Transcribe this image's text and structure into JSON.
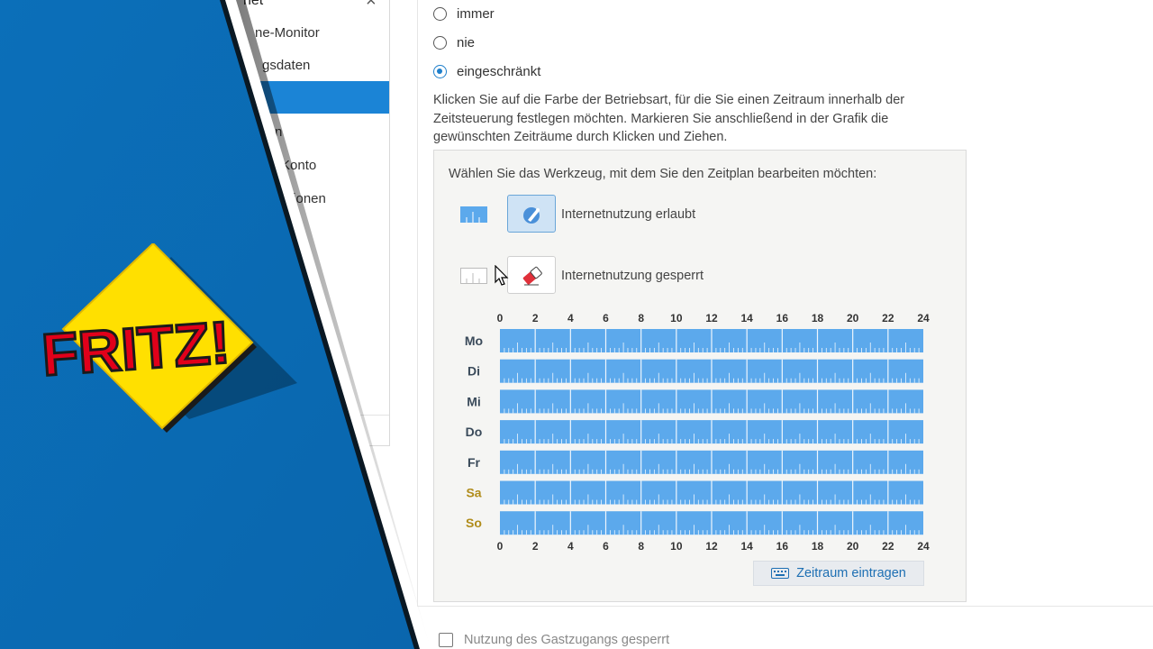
{
  "sidebar": {
    "head": "net",
    "items": [
      {
        "label": "ne-Monitor",
        "active": false
      },
      {
        "label": "gsdaten",
        "active": false
      },
      {
        "label": "",
        "active": true
      },
      {
        "label": "n",
        "active": false
      },
      {
        "label": "Konto",
        "active": false
      },
      {
        "label": "tionen",
        "active": false
      }
    ]
  },
  "logo": {
    "text": "FRITZ!"
  },
  "options": {
    "immer": "immer",
    "nie": "nie",
    "eingeschraenkt": "eingeschränkt",
    "selected": "eingeschraenkt"
  },
  "description": "Klicken Sie auf die Farbe der Betriebsart, für die Sie einen Zeitraum innerhalb der Zeitsteuerung festlegen möchten. Markieren Sie anschließend in der Grafik die gewünschten Zeiträume durch Klicken und Ziehen.",
  "panel": {
    "title": "Wählen Sie das Werkzeug, mit dem Sie den Zeitplan bearbeiten möchten:",
    "tools": [
      {
        "label": "Internetnutzung erlaubt",
        "selected": true,
        "icon": "pencil-icon"
      },
      {
        "label": "Internetnutzung gesperrt",
        "selected": false,
        "icon": "eraser-icon"
      }
    ]
  },
  "schedule": {
    "hours": [
      "0",
      "2",
      "4",
      "6",
      "8",
      "10",
      "12",
      "14",
      "16",
      "18",
      "20",
      "22",
      "24"
    ],
    "days": [
      {
        "label": "Mo",
        "weekend": false
      },
      {
        "label": "Di",
        "weekend": false
      },
      {
        "label": "Mi",
        "weekend": false
      },
      {
        "label": "Do",
        "weekend": false
      },
      {
        "label": "Fr",
        "weekend": false
      },
      {
        "label": "Sa",
        "weekend": true
      },
      {
        "label": "So",
        "weekend": true
      }
    ],
    "allowed_color": "#5ca9ec",
    "weekday_color": "#3a4a5a",
    "weekend_color": "#b08c1a"
  },
  "buttons": {
    "zeitraum": "Zeitraum eintragen"
  },
  "guest": {
    "label": "Nutzung des Gastzugangs gesperrt"
  },
  "colors": {
    "overlay_blue": "#0a6fb8",
    "accent": "#1e7fcb"
  }
}
